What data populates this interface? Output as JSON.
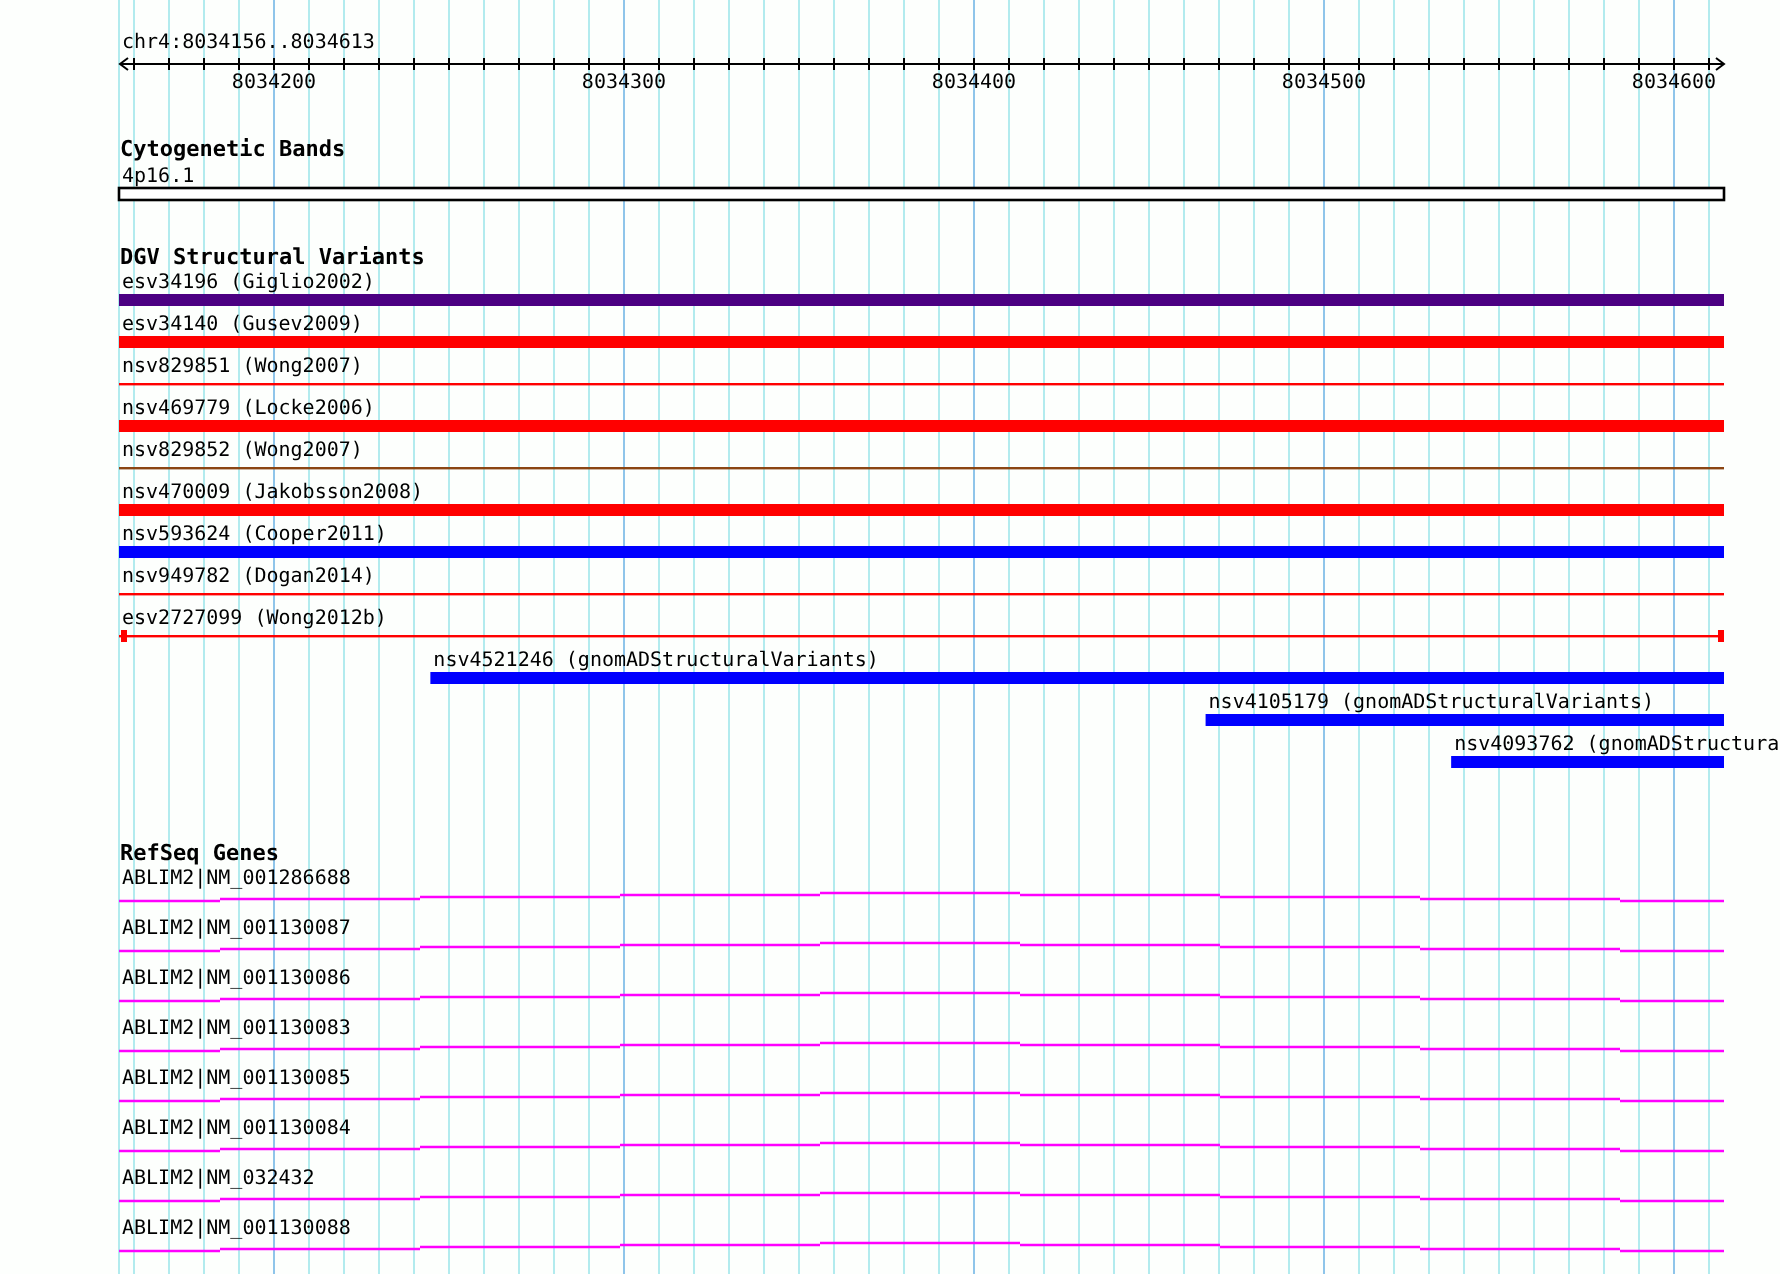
{
  "ruler": {
    "region": "chr4:8034156..8034613",
    "tick_labels": [
      "8034200",
      "8034300",
      "8034400",
      "8034500",
      "8034600"
    ]
  },
  "tracks": [
    {
      "title": "Cytogenetic Bands",
      "kind": "bands",
      "features": [
        {
          "label": "4p16.1"
        }
      ]
    },
    {
      "title": "DGV Structural Variants",
      "kind": "variants",
      "features": [
        {
          "label": "esv34196 (Giglio2002)",
          "color": "#4b0082",
          "kind": "thick"
        },
        {
          "label": "esv34140 (Gusev2009)",
          "color": "#ff0000",
          "kind": "thick"
        },
        {
          "label": "nsv829851 (Wong2007)",
          "color": "#ff0000",
          "kind": "thin"
        },
        {
          "label": "nsv469779 (Locke2006)",
          "color": "#ff0000",
          "kind": "thick"
        },
        {
          "label": "nsv829852 (Wong2007)",
          "color": "#8b4513",
          "kind": "thin"
        },
        {
          "label": "nsv470009 (Jakobsson2008)",
          "color": "#ff0000",
          "kind": "thick"
        },
        {
          "label": "nsv593624 (Cooper2011)",
          "color": "#0000ff",
          "kind": "thick"
        },
        {
          "label": "nsv949782 (Dogan2014)",
          "color": "#ff0000",
          "kind": "thin"
        },
        {
          "label": "esv2727099 (Wong2012b)",
          "color": "#ff0000",
          "kind": "interval"
        },
        {
          "label": "nsv4521246 (gnomADStructuralVariants)",
          "color": "#0000ff",
          "kind": "thick"
        },
        {
          "label": "nsv4105179 (gnomADStructuralVariants)",
          "color": "#0000ff",
          "kind": "thick"
        },
        {
          "label": "nsv4093762 (gnomADStructura",
          "color": "#0000ff",
          "kind": "thick"
        }
      ]
    },
    {
      "title": "RefSeq Genes",
      "kind": "genes",
      "features": [
        {
          "label": "ABLIM2|NM_001286688"
        },
        {
          "label": "ABLIM2|NM_001130087"
        },
        {
          "label": "ABLIM2|NM_001130086"
        },
        {
          "label": "ABLIM2|NM_001130083"
        },
        {
          "label": "ABLIM2|NM_001130085"
        },
        {
          "label": "ABLIM2|NM_001130084"
        },
        {
          "label": "ABLIM2|NM_032432"
        },
        {
          "label": "ABLIM2|NM_001130088"
        }
      ]
    }
  ]
}
